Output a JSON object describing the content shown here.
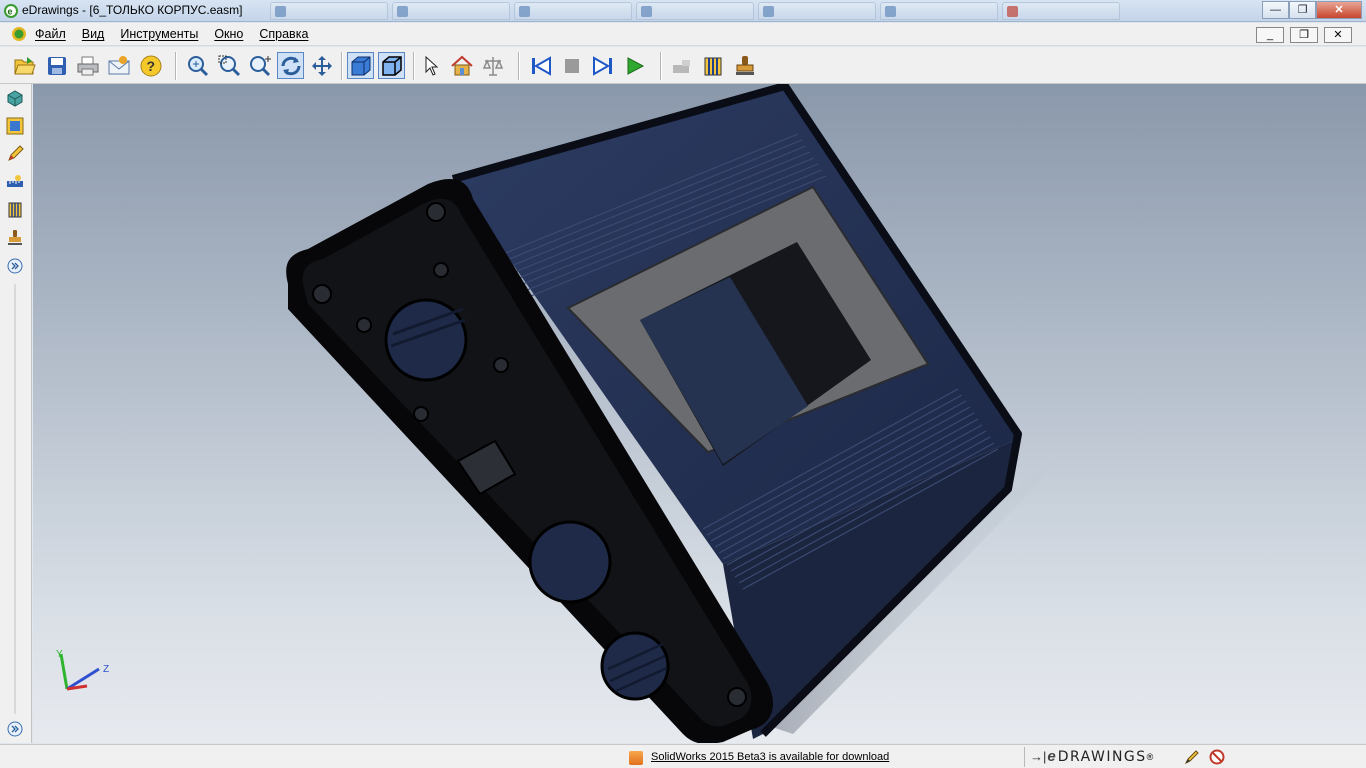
{
  "window": {
    "title": "eDrawings - [6_ТОЛЬКО КОРПУС.easm]",
    "app_icon": "edrawings-icon",
    "controls": {
      "minimize": "—",
      "maximize": "❐",
      "close": "✕"
    }
  },
  "menubar": {
    "items": [
      "Файл",
      "Вид",
      "Инструменты",
      "Окно",
      "Справка"
    ],
    "mdi_controls": {
      "minimize": "_",
      "restore": "❐",
      "close": "✕"
    }
  },
  "toolbar": {
    "groups": [
      [
        "open-icon",
        "save-icon",
        "print-icon",
        "send-icon",
        "help-icon"
      ],
      [
        "zoom-to-fit-icon",
        "zoom-to-area-icon",
        "zoom-in-out-icon",
        "rotate-icon",
        "pan-icon"
      ],
      [
        "shaded-view-icon",
        "shaded-with-edges-icon"
      ],
      [
        "select-icon",
        "home-view-icon",
        "measure-icon"
      ],
      [
        "first-frame-icon",
        "stop-icon",
        "next-frame-icon",
        "play-icon"
      ],
      [
        "move-component-icon",
        "section-icon",
        "stamp-icon"
      ]
    ],
    "pressed": [
      "rotate-icon",
      "shaded-view-icon",
      "shaded-with-edges-icon"
    ]
  },
  "leftbar": {
    "icons": [
      "components-icon",
      "configurations-icon",
      "markup-icon",
      "measure-tool-icon",
      "section-tool-icon",
      "stamp-tool-icon",
      "expand-panel-icon"
    ],
    "bottom_icon": "expand-panel-icon"
  },
  "viewport": {
    "triad": {
      "y_label": "Y",
      "z_label": "Z"
    }
  },
  "statusbar": {
    "feed_icon": "rss-icon",
    "message": "SolidWorks 2015 Beta3 is available for download",
    "brand": {
      "prefix": "→|",
      "e": "e",
      "name": "DRAWINGS",
      "reg": "®"
    },
    "icons": [
      "markup-pencil-icon",
      "no-markup-icon"
    ]
  },
  "colors": {
    "enclosure_body": "#263457",
    "panel": "#0c0c0e",
    "bezel": "#6a6c70",
    "screen": "#253350",
    "viewport_top": "#8a98ab"
  }
}
